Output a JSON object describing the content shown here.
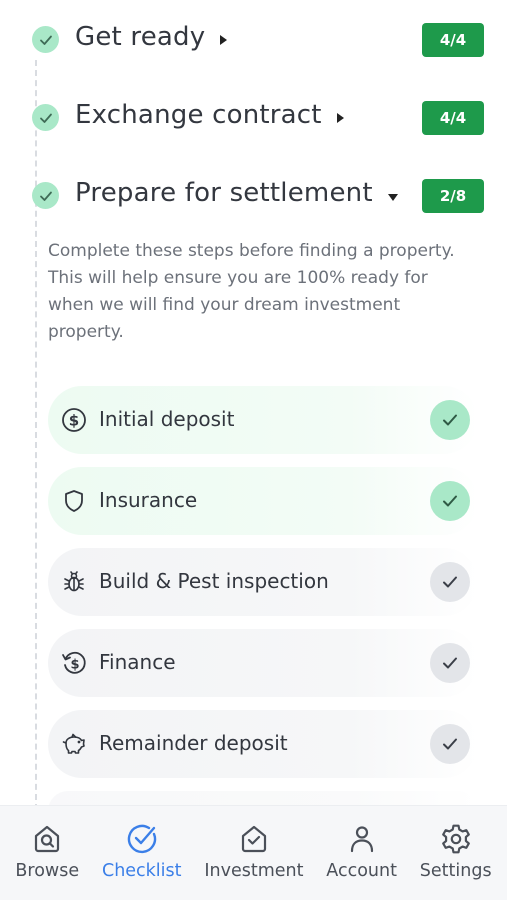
{
  "sections": [
    {
      "title": "Get ready",
      "badge": "4/4",
      "expanded": false
    },
    {
      "title": "Exchange contract",
      "badge": "4/4",
      "expanded": false
    },
    {
      "title": "Prepare for settlement",
      "badge": "2/8",
      "expanded": true
    }
  ],
  "description": "Complete these steps before finding a property. This will help ensure you are 100% ready for when we will find your dream investment property.",
  "steps": [
    {
      "label": "Initial deposit",
      "icon": "dollar-circle-icon",
      "done": true
    },
    {
      "label": "Insurance",
      "icon": "shield-icon",
      "done": true
    },
    {
      "label": "Build & Pest inspection",
      "icon": "bug-icon",
      "done": false
    },
    {
      "label": "Finance",
      "icon": "dollar-refresh-icon",
      "done": false
    },
    {
      "label": "Remainder deposit",
      "icon": "piggy-bank-icon",
      "done": false
    }
  ],
  "nav": [
    {
      "label": "Browse",
      "icon": "browse-house-search-icon",
      "active": false
    },
    {
      "label": "Checklist",
      "icon": "checklist-icon",
      "active": true
    },
    {
      "label": "Investment",
      "icon": "investment-house-icon",
      "active": false
    },
    {
      "label": "Account",
      "icon": "account-person-icon",
      "active": false
    },
    {
      "label": "Settings",
      "icon": "settings-gear-icon",
      "active": false
    }
  ],
  "colors": {
    "badge": "#1e9a4b",
    "done_check": "#a9e8c8",
    "pending_check": "#e3e5e9",
    "nav_active": "#3b7fe8"
  }
}
